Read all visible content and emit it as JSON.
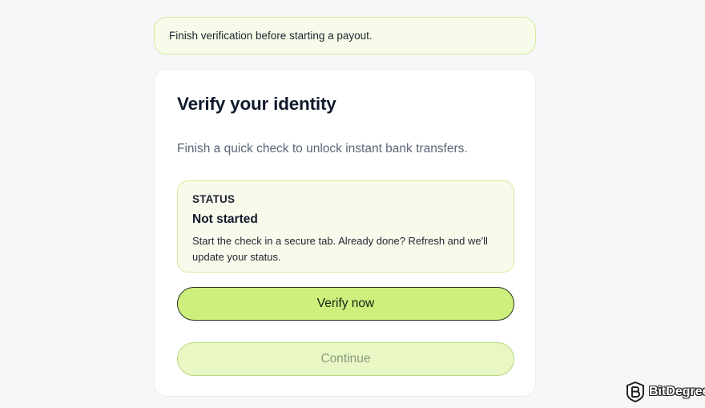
{
  "banner": {
    "text": "Finish verification before starting a payout."
  },
  "card": {
    "title": "Verify your identity",
    "subtitle": "Finish a quick check to unlock instant bank transfers.",
    "status": {
      "label": "STATUS",
      "value": "Not started",
      "description": "Start the check in a secure tab. Already done? Refresh and we'll update your status."
    },
    "primary_button": "Verify now",
    "continue_button": "Continue"
  },
  "watermark": {
    "text": "BitDegree"
  },
  "colors": {
    "accent": "#cdf07d",
    "accent_border": "#d7ea9c",
    "disabled_bg": "#e8f7c4",
    "page_bg": "#f5f7f9"
  }
}
